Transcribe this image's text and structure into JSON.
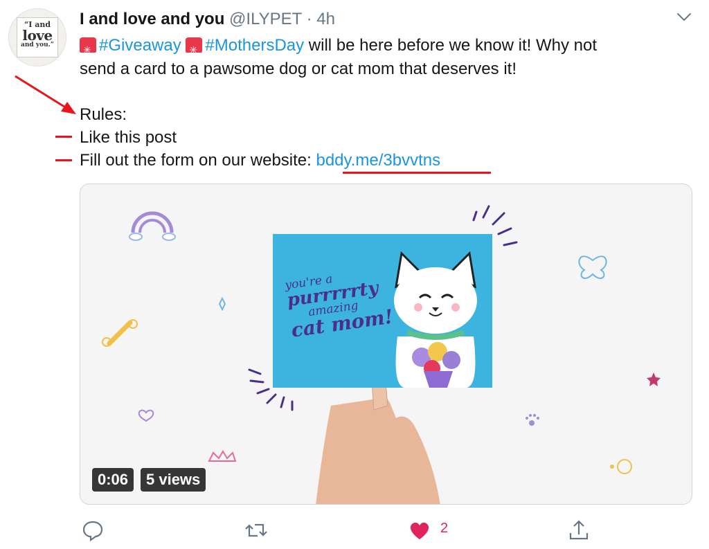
{
  "tweet": {
    "author": {
      "name": "I and love and you",
      "handle": "@ILYPET",
      "separator": "·",
      "time": "4h",
      "avatar_text": [
        "“I and",
        "love",
        "and you.”"
      ]
    },
    "line1": {
      "hashtag1": "#Giveaway",
      "hashtag2": "#MothersDay",
      "rest": " will be here before we know it! Why not"
    },
    "line2": "send a card to a pawsome dog or cat mom that deserves it!",
    "rules_heading": "Rules:",
    "rule1": "Like this post",
    "rule2_prefix": "Fill out the form on our website: ",
    "rule2_link": "bddy.me/3bvvtns"
  },
  "media": {
    "card_text": [
      "you're a",
      "purrrrrty",
      "amazing",
      "cat mom!"
    ],
    "duration": "0:06",
    "views": "5 views"
  },
  "actions": {
    "like_count": "2"
  },
  "colors": {
    "link": "#1b95e0",
    "like": "#e0245e",
    "annotation": "#e8141e",
    "card_bg": "#3db4e0"
  },
  "icons": [
    "chevron-down-icon",
    "siren-icon",
    "reply-icon",
    "retweet-icon",
    "heart-icon",
    "share-icon",
    "annotation-arrow-icon"
  ]
}
